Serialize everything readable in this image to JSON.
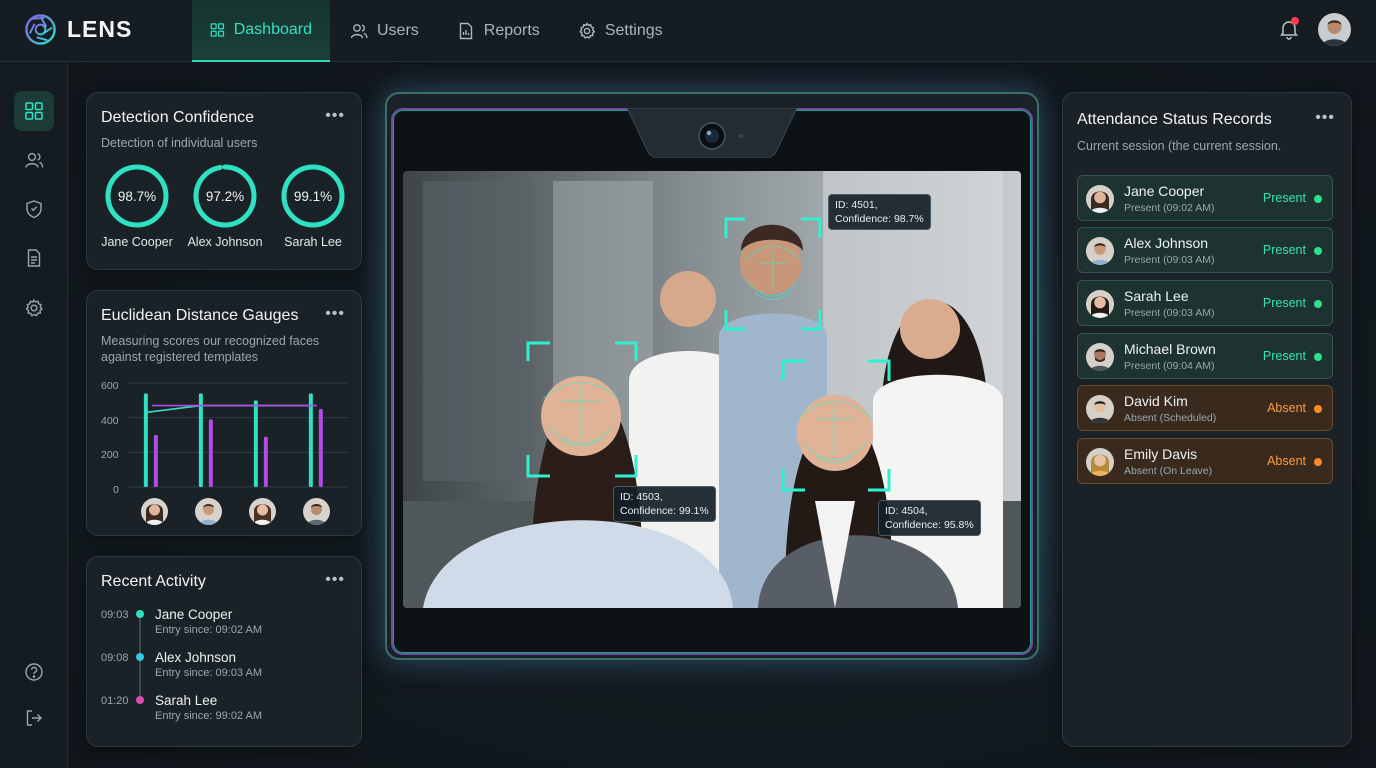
{
  "app": {
    "name": "LENS"
  },
  "nav": [
    {
      "label": "Dashboard",
      "icon": "grid-icon",
      "active": true
    },
    {
      "label": "Users",
      "icon": "users-icon"
    },
    {
      "label": "Reports",
      "icon": "report-icon"
    },
    {
      "label": "Settings",
      "icon": "gear-icon"
    }
  ],
  "sidebar": [
    {
      "icon": "grid-icon",
      "active": true
    },
    {
      "icon": "users-icon"
    },
    {
      "icon": "shield-icon"
    },
    {
      "icon": "document-icon"
    },
    {
      "icon": "gear-icon"
    },
    {
      "icon": "help-icon"
    },
    {
      "icon": "logout-icon"
    }
  ],
  "confidence": {
    "title": "Detection Confidence",
    "subtitle": "Detection of individual users",
    "gauges": [
      {
        "value": "98.7%",
        "name": "Jane Cooper"
      },
      {
        "value": "97.2%",
        "name": "Alex Johnson"
      },
      {
        "value": "99.1%",
        "name": "Sarah Lee"
      }
    ]
  },
  "euclid": {
    "title": "Euclidean Distance Gauges",
    "subtitle_line1": "Measuring scores our recognized faces",
    "subtitle_line2": "against registered templates",
    "yticks": [
      "600",
      "400",
      "200",
      "0"
    ]
  },
  "chart_data": {
    "type": "bar",
    "categories": [
      "Jane Cooper",
      "Alex Johnson",
      "Sarah Lee",
      "Michael Brown"
    ],
    "ylim": [
      0,
      600
    ],
    "series": [
      {
        "values": [
          540,
          540,
          500,
          540
        ]
      },
      {
        "values": [
          300,
          390,
          290,
          450
        ]
      }
    ],
    "overlay_lines": [
      {
        "values": [
          430,
          470,
          470,
          470
        ]
      },
      {
        "values": [
          470,
          470,
          470,
          470
        ]
      }
    ],
    "colors": {
      "primary": "#2fe0c2",
      "secondary": "#b24be8"
    }
  },
  "activity": {
    "title": "Recent Activity",
    "items": [
      {
        "time": "09:03",
        "name": "Jane Cooper",
        "sub": "Entry since: 09:02 AM",
        "color": "#2fe0c2"
      },
      {
        "time": "09:08",
        "name": "Alex Johnson",
        "sub": "Entry since: 09:03 AM",
        "color": "#35c8e0"
      },
      {
        "time": "01:20",
        "name": "Sarah Lee",
        "sub": "Entry since: 99:02 AM",
        "color": "#e04ab2"
      }
    ]
  },
  "camera": {
    "labels": [
      {
        "id": "ID: 4501,",
        "conf": "Confidence: 98.7%"
      },
      {
        "id": "ID: 4503,",
        "conf": "Confidence: 99.1%"
      },
      {
        "id": "ID: 4504,",
        "conf": "Confidence: 95.8%"
      }
    ]
  },
  "attendance": {
    "title": "Attendance Status Records",
    "subtitle": "Current session (the current session.",
    "rows": [
      {
        "name": "Jane Cooper",
        "sub": "Present (09:02 AM)",
        "status": "Present",
        "state": "present"
      },
      {
        "name": "Alex Johnson",
        "sub": "Present (09:03 AM)",
        "status": "Present",
        "state": "present"
      },
      {
        "name": "Sarah Lee",
        "sub": "Present (09:03 AM)",
        "status": "Present",
        "state": "present"
      },
      {
        "name": "Michael Brown",
        "sub": "Present (09:04 AM)",
        "status": "Present",
        "state": "present"
      },
      {
        "name": "David Kim",
        "sub": "Absent (Scheduled)",
        "status": "Absent",
        "state": "absent"
      },
      {
        "name": "Emily Davis",
        "sub": "Absent (On Leave)",
        "status": "Absent",
        "state": "absent"
      }
    ]
  },
  "colors": {
    "accent": "#2fe0c2",
    "purple": "#b24be8",
    "absent": "#ff9a3c"
  }
}
